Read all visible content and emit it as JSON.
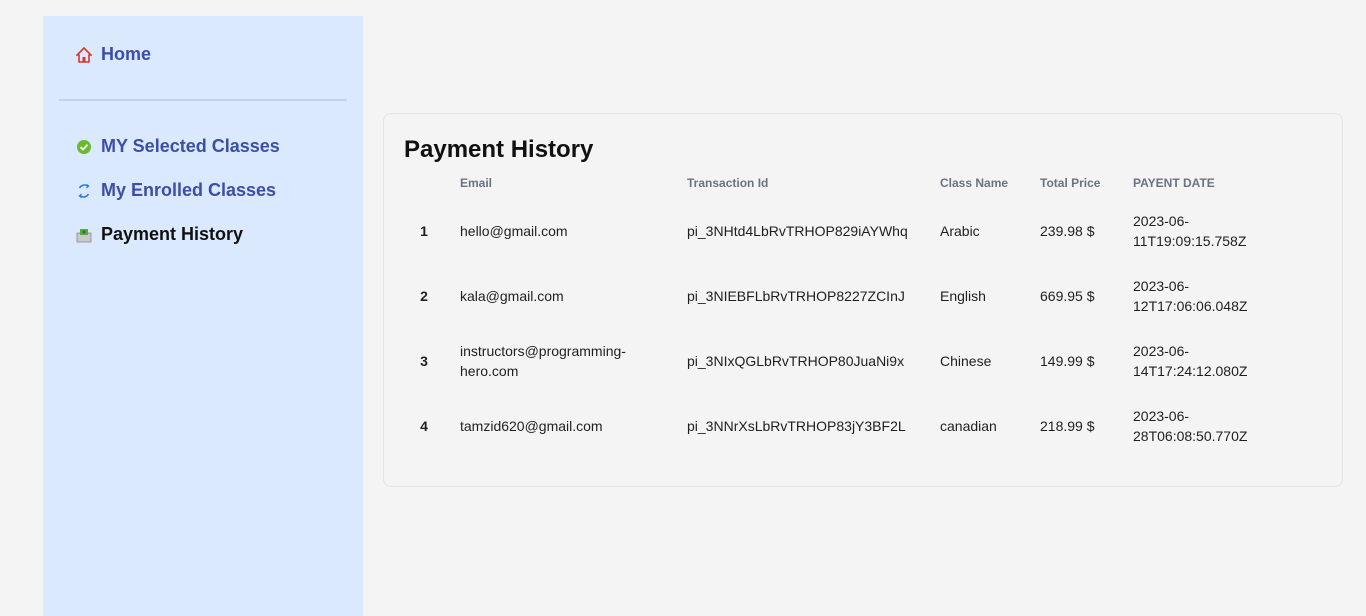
{
  "sidebar": {
    "home": {
      "label": "Home",
      "icon": "home-icon"
    },
    "items": [
      {
        "label": "MY Selected Classes",
        "icon": "check-circle-icon"
      },
      {
        "label": "My Enrolled Classes",
        "icon": "refresh-icon"
      },
      {
        "label": "Payment History",
        "icon": "money-icon"
      }
    ]
  },
  "main": {
    "title": "Payment History",
    "table": {
      "headers": [
        "",
        "Email",
        "Transaction Id",
        "Class Name",
        "Total Price",
        "PAYENT DATE"
      ],
      "rows": [
        {
          "index": "1",
          "email": "hello@gmail.com",
          "transaction_id": "pi_3NHtd4LbRvTRHOP829iAYWhq",
          "class_name": "Arabic",
          "total_price": "239.98 $",
          "date_a": "2023-06-",
          "date_b": "11T19:09:15.758Z"
        },
        {
          "index": "2",
          "email": "kala@gmail.com",
          "transaction_id": "pi_3NIEBFLbRvTRHOP8227ZCInJ",
          "class_name": "English",
          "total_price": "669.95 $",
          "date_a": "2023-06-",
          "date_b": "12T17:06:06.048Z"
        },
        {
          "index": "3",
          "email_a": "instructors@programming-",
          "email_b": "hero.com",
          "transaction_id": "pi_3NIxQGLbRvTRHOP80JuaNi9x",
          "class_name": "Chinese",
          "total_price": "149.99 $",
          "date_a": "2023-06-",
          "date_b": "14T17:24:12.080Z"
        },
        {
          "index": "4",
          "email": "tamzid620@gmail.com",
          "transaction_id": "pi_3NNrXsLbRvTRHOP83jY3BF2L",
          "class_name": "canadian",
          "total_price": "218.99 $",
          "date_a": "2023-06-",
          "date_b": "28T06:08:50.770Z"
        }
      ]
    }
  }
}
